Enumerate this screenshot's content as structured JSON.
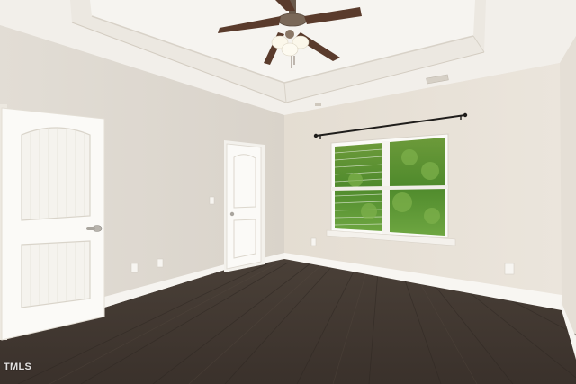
{
  "photo": {
    "watermark": "TMLS"
  }
}
